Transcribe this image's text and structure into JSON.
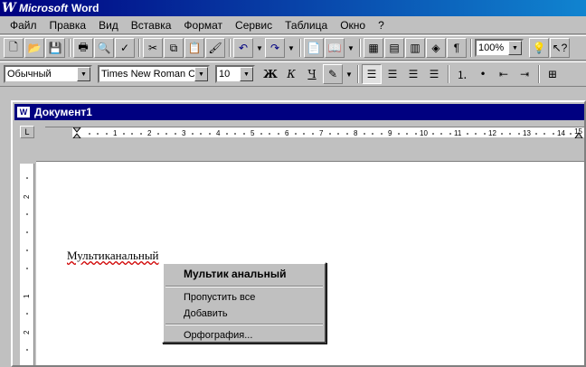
{
  "app": {
    "logo": "W",
    "title_prefix": "Microsoft",
    "title_suffix": "Word"
  },
  "menu": [
    "Файл",
    "Правка",
    "Вид",
    "Вставка",
    "Формат",
    "Сервис",
    "Таблица",
    "Окно",
    "?"
  ],
  "toolbar": {
    "zoom": "100%"
  },
  "format_toolbar": {
    "style": "Обычный",
    "font": "Times New Roman C",
    "size": "10",
    "bold": "Ж",
    "italic": "К",
    "underline": "Ч"
  },
  "document": {
    "title": "Документ1",
    "text": "Мультиканальный"
  },
  "ruler": {
    "end_mark": "15"
  },
  "context_menu": {
    "suggestion": "Мультик анальный",
    "ignore_all": "Пропустить все",
    "add": "Добавить",
    "spelling": "Орфография..."
  }
}
